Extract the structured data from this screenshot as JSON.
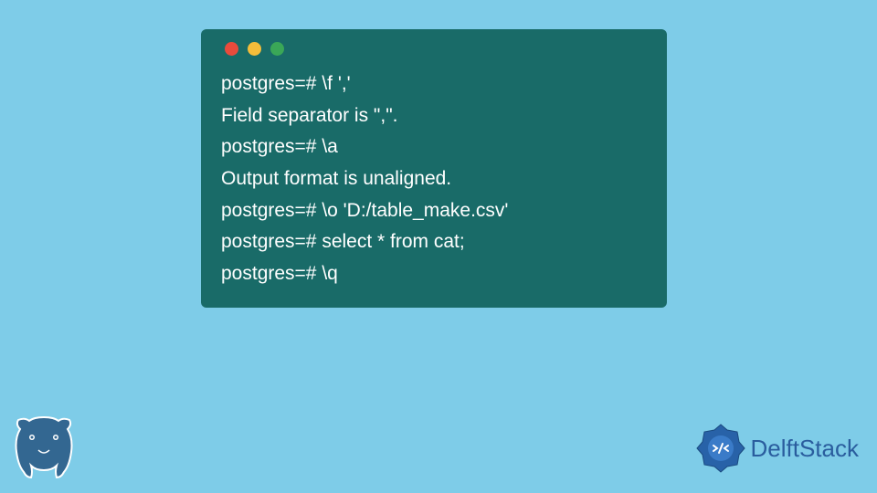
{
  "terminal": {
    "lines": [
      "postgres=# \\f ','",
      "Field separator is \",\".",
      "postgres=# \\a",
      "Output format is unaligned.",
      "postgres=# \\o 'D:/table_make.csv'",
      "postgres=# select * from cat;",
      "postgres=# \\q"
    ]
  },
  "branding": {
    "name": "DelftStack"
  }
}
